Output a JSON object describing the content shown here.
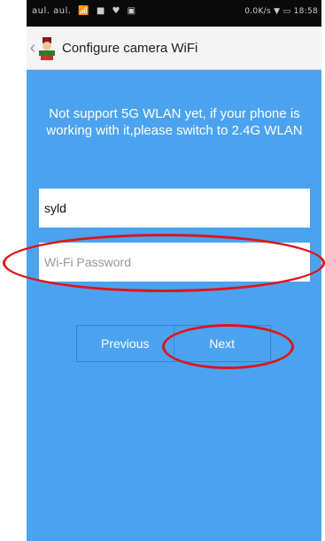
{
  "status_bar": {
    "signal_text": "aul. aul.",
    "icons": [
      "wifi-icon",
      "image-icon",
      "heart-icon",
      "app-icon"
    ],
    "network_speed": "0.0K/s",
    "clock": "18:58"
  },
  "header": {
    "title": "Configure camera WiFi"
  },
  "main": {
    "notice": "Not support 5G WLAN yet, if your phone is working with it,please switch to 2.4G WLAN",
    "ssid_value": "syld",
    "password_placeholder": "Wi-Fi Password",
    "buttons": {
      "previous": "Previous",
      "next": "Next"
    }
  },
  "colors": {
    "background": "#4ba3ef",
    "annotation": "#e0141b"
  }
}
